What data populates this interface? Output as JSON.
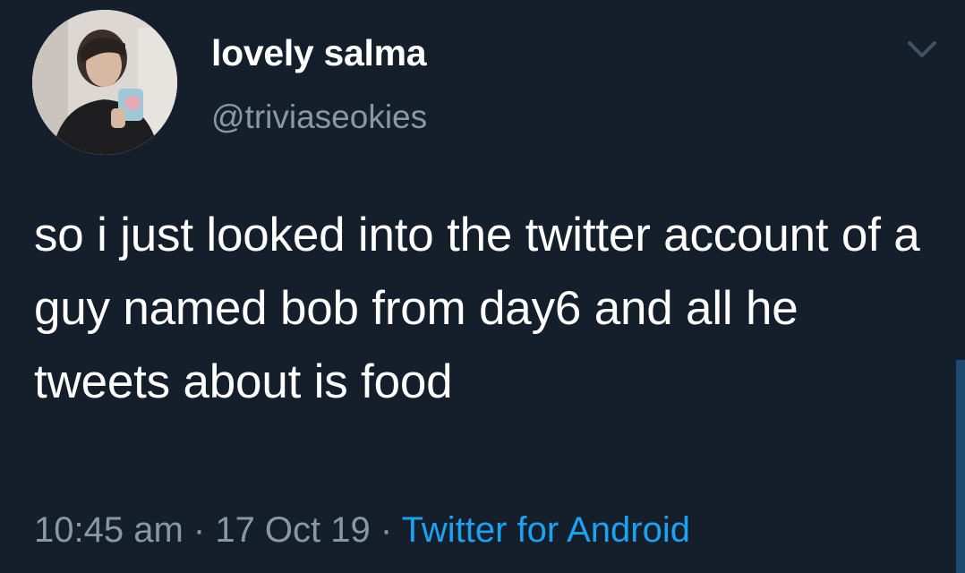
{
  "user": {
    "display_name": "lovely salma",
    "handle": "@triviaseokies",
    "avatar_icon": "profile-photo-icon"
  },
  "tweet": {
    "text": "so i just looked into the twitter account of a guy named bob from day6 and all he tweets about is food"
  },
  "meta": {
    "time": "10:45 am",
    "separator": " · ",
    "date": "17 Oct 19",
    "source": "Twitter for Android"
  },
  "icons": {
    "menu": "chevron-down-icon"
  },
  "colors": {
    "background": "#151f2b",
    "text": "#ffffff",
    "secondary": "#8899a6",
    "link": "#1da1f2"
  }
}
